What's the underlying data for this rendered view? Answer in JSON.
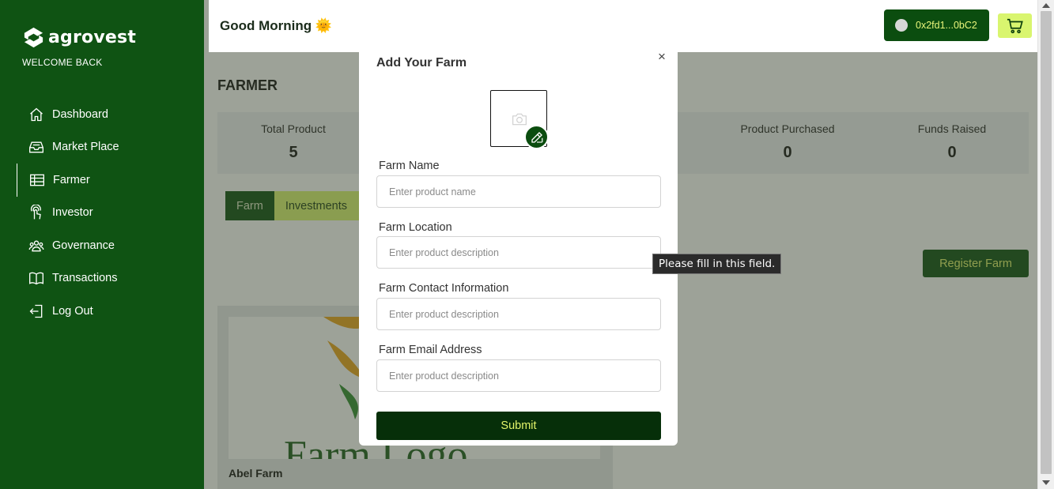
{
  "brand": {
    "name": "agrovest",
    "welcome": "WELCOME BACK"
  },
  "sidebar": {
    "items": [
      {
        "label": "Dashboard",
        "icon": "home-icon"
      },
      {
        "label": "Market Place",
        "icon": "inbox-icon"
      },
      {
        "label": "Farmer",
        "icon": "table-icon",
        "active": true
      },
      {
        "label": "Investor",
        "icon": "pointer-icon"
      },
      {
        "label": "Governance",
        "icon": "users-icon"
      },
      {
        "label": "Transactions",
        "icon": "book-icon"
      },
      {
        "label": "Log Out",
        "icon": "logout-icon"
      }
    ]
  },
  "header": {
    "greeting": "Good Morning 🌞",
    "wallet_address": "0x2fd1...0bC2"
  },
  "page": {
    "title": "FARMER",
    "stats": [
      {
        "label": "Total Product",
        "value": "5"
      },
      {
        "label": "Product Purchased",
        "value": "0"
      },
      {
        "label": "Funds Raised",
        "value": "0"
      }
    ],
    "tabs": [
      "Farm",
      "Investments"
    ],
    "register_label": "Register Farm",
    "card_name": "Abel Farm",
    "card_image_text": "Farm Logo"
  },
  "modal": {
    "title": "Add Your Farm",
    "close": "×",
    "fields": [
      {
        "label": "Farm Name",
        "placeholder": "Enter product name"
      },
      {
        "label": "Farm Location",
        "placeholder": "Enter product description"
      },
      {
        "label": "Farm Contact Information",
        "placeholder": "Enter product description"
      },
      {
        "label": "Farm Email Address",
        "placeholder": "Enter product description"
      }
    ],
    "submit": "Submit"
  },
  "tooltip": "Please fill in this field.",
  "colors": {
    "sidebar": "#0f5313",
    "accent_dark": "#0b4d0f",
    "accent_lime": "#d9f56f"
  }
}
